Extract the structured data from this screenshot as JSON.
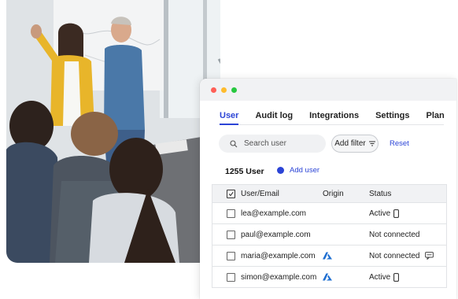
{
  "app": {
    "tabs": [
      {
        "label": "User",
        "active": true
      },
      {
        "label": "Audit log",
        "active": false
      },
      {
        "label": "Integrations",
        "active": false
      },
      {
        "label": "Settings",
        "active": false
      },
      {
        "label": "Plan",
        "active": false
      }
    ],
    "search": {
      "placeholder": "Search user",
      "icon": "search-icon"
    },
    "filter": {
      "label": "Add filter",
      "icon": "filter-icon"
    },
    "reset_label": "Reset",
    "user_count": "1255 User",
    "add_user_label": "Add user",
    "table": {
      "columns": [
        "User/Email",
        "Origin",
        "Status"
      ],
      "rows": [
        {
          "email": "lea@example.com",
          "origin_icon": "",
          "status": "Active",
          "status_icon": "phone-icon",
          "extra_icon": ""
        },
        {
          "email": "paul@example.com",
          "origin_icon": "",
          "status": "Not connected",
          "status_icon": "",
          "extra_icon": ""
        },
        {
          "email": "maria@example.com",
          "origin_icon": "azure-icon",
          "status": "Not connected",
          "status_icon": "",
          "extra_icon": "message-icon"
        },
        {
          "email": "simon@example.com",
          "origin_icon": "azure-icon",
          "status": "Active",
          "status_icon": "phone-icon",
          "extra_icon": ""
        }
      ]
    },
    "colors": {
      "accent": "#2b44d6",
      "azure": "#1f6fd1"
    }
  }
}
